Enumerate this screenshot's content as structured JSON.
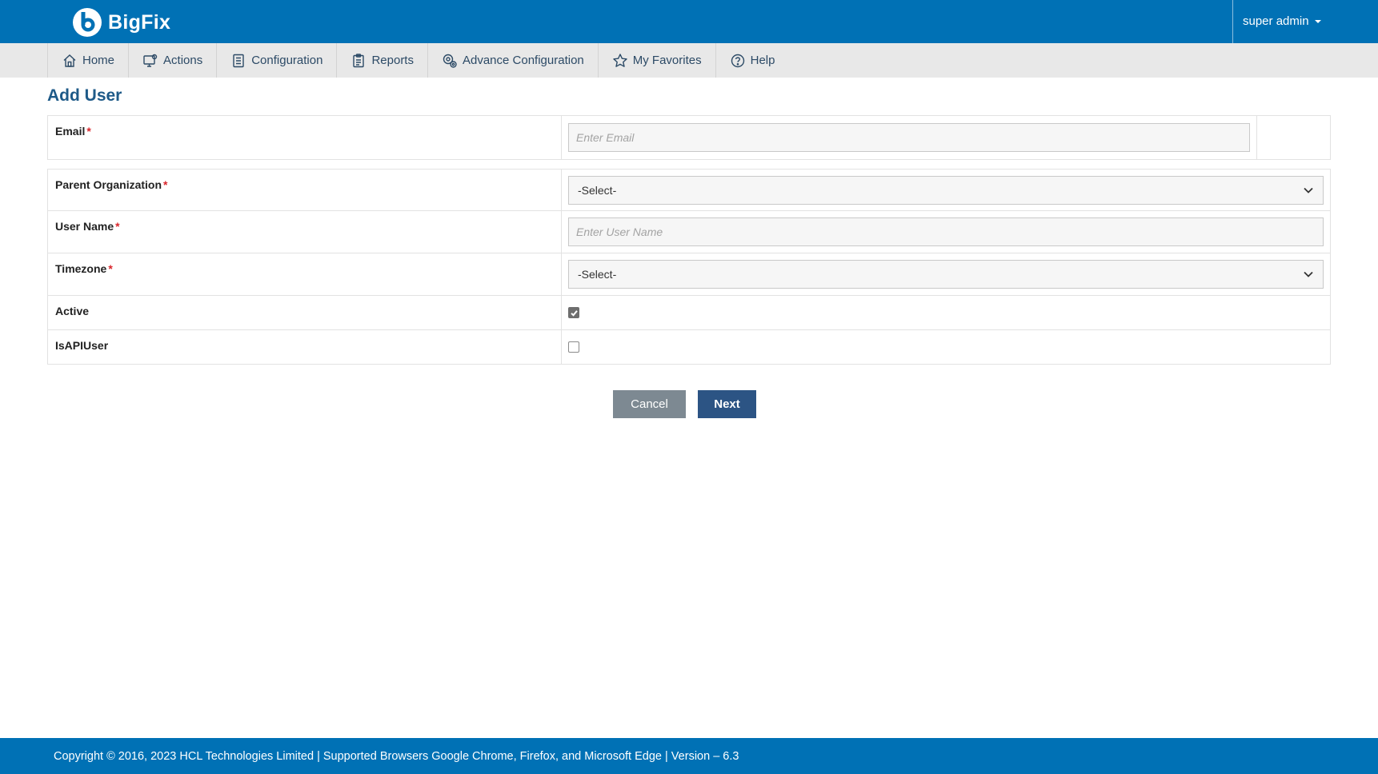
{
  "header": {
    "brand": "BigFix",
    "user_label": "super admin"
  },
  "nav": {
    "items": [
      {
        "label": "Home",
        "icon": "home-icon"
      },
      {
        "label": "Actions",
        "icon": "actions-icon"
      },
      {
        "label": "Configuration",
        "icon": "configuration-icon"
      },
      {
        "label": "Reports",
        "icon": "reports-icon"
      },
      {
        "label": "Advance Configuration",
        "icon": "advance-configuration-icon"
      },
      {
        "label": "My Favorites",
        "icon": "star-icon"
      },
      {
        "label": "Help",
        "icon": "help-icon"
      }
    ]
  },
  "page": {
    "title": "Add User"
  },
  "form": {
    "email": {
      "label": "Email",
      "required": "*",
      "placeholder": "Enter Email",
      "value": ""
    },
    "parent_org": {
      "label": "Parent Organization",
      "required": "*",
      "selected": "-Select-"
    },
    "username": {
      "label": "User Name",
      "required": "*",
      "placeholder": "Enter User Name",
      "value": ""
    },
    "timezone": {
      "label": "Timezone",
      "required": "*",
      "selected": "-Select-"
    },
    "active": {
      "label": "Active",
      "checked": true
    },
    "isapiuser": {
      "label": "IsAPIUser",
      "checked": false
    }
  },
  "buttons": {
    "cancel": "Cancel",
    "next": "Next"
  },
  "footer": {
    "text": "Copyright © 2016, 2023 HCL Technologies Limited | Supported Browsers Google Chrome, Firefox, and Microsoft Edge | Version – 6.3"
  },
  "colors": {
    "brand_blue": "#0071b5",
    "nav_bg": "#e8e8e8",
    "title_blue": "#1e5a88",
    "required_red": "#d9262c",
    "cancel_gray": "#7d8992",
    "next_navy": "#2c5484"
  }
}
